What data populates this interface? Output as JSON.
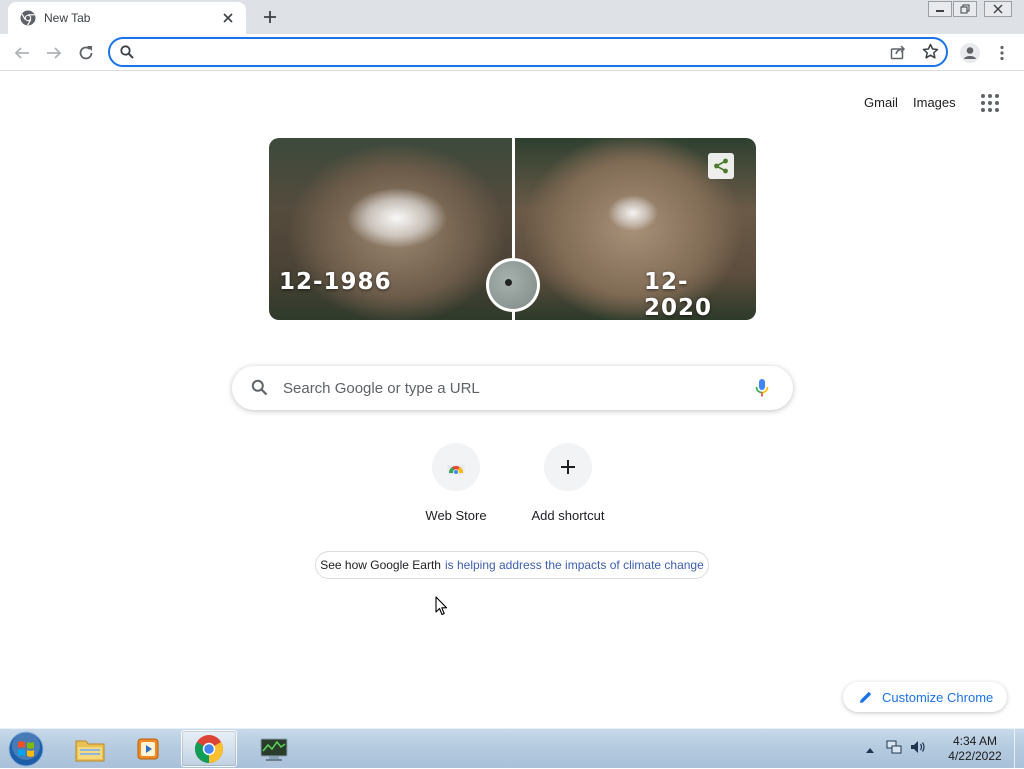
{
  "browser": {
    "tab": {
      "title": "New Tab",
      "favicon": "chrome-icon",
      "close_icon": "close-icon"
    },
    "new_tab_icon": "plus-icon",
    "window_controls": [
      "minimize-icon",
      "restore-icon",
      "close-icon"
    ],
    "toolbar": {
      "back_icon": "arrow-left-icon",
      "forward_icon": "arrow-right-icon",
      "reload_icon": "reload-icon",
      "omnibox_value": "",
      "omnibox_icon": "search-icon",
      "share_icon": "share-icon",
      "bookmark_icon": "star-icon",
      "profile_icon": "avatar-icon",
      "menu_icon": "kebab-menu-icon"
    }
  },
  "ntp": {
    "top_links": {
      "gmail": "Gmail",
      "images": "Images"
    },
    "apps_icon": "grid-apps-icon",
    "doodle": {
      "left_year": "12-1986",
      "right_year": "12-2020"
    },
    "search": {
      "placeholder": "Search Google or type a URL",
      "value": ""
    },
    "shortcuts": [
      {
        "label": "Web Store",
        "icon": "chrome-web-store-icon"
      },
      {
        "label": "Add shortcut",
        "icon": "plus-icon"
      }
    ],
    "promo": {
      "text": "See how Google Earth",
      "link_text": "is helping address the impacts of climate change"
    },
    "customize": {
      "label": "Customize Chrome",
      "icon": "pencil-icon"
    }
  },
  "taskbar": {
    "start_icon": "windows-start-icon",
    "apps": [
      "file-explorer-icon",
      "media-player-icon",
      "chrome-icon",
      "system-monitor-icon"
    ],
    "clock": {
      "time": "4:34 AM",
      "date": "4/22/2022"
    },
    "tray_icons": [
      "tray-up-arrow-icon",
      "network-icon",
      "volume-icon"
    ]
  },
  "colors": {
    "accent": "#1a73e8",
    "tabstrip": "#dee1e6",
    "taskbar": "#b4cadf",
    "link": "#3c5fb0"
  }
}
